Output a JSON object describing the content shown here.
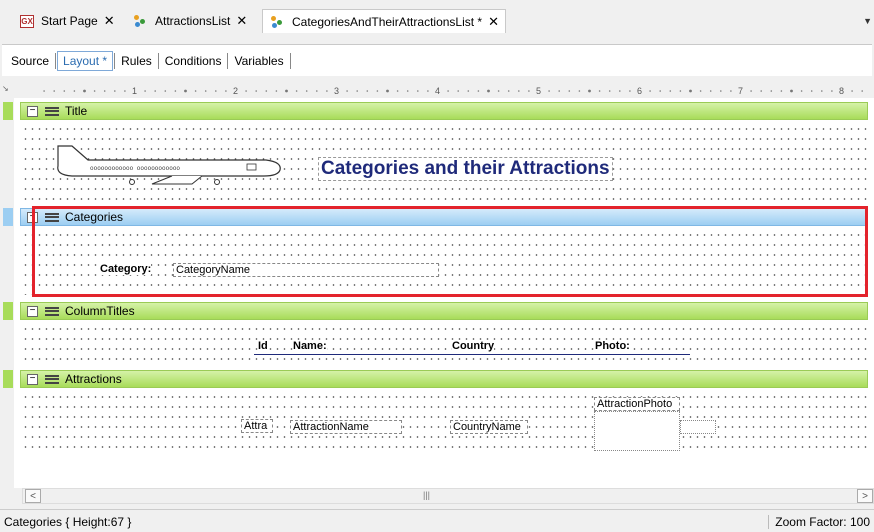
{
  "tabs": [
    {
      "label": "Start Page",
      "close": "✕",
      "icon": "gx-logo-icon"
    },
    {
      "label": "AttractionsList",
      "close": "✕",
      "icon": "object-icon"
    },
    {
      "label": "CategoriesAndTheirAttractionsList *",
      "close": "✕",
      "icon": "object-icon",
      "active": true
    }
  ],
  "gx_logo_text": "GX",
  "subtabs": [
    "Source",
    "Layout *",
    "Rules",
    "Conditions",
    "Variables"
  ],
  "ruler": {
    "marks": [
      "1",
      "2",
      "3",
      "4",
      "5",
      "6",
      "7",
      "8"
    ]
  },
  "bands": {
    "title": {
      "label": "Title",
      "heading": "Categories and their Attractions"
    },
    "categories": {
      "label": "Categories",
      "field_label": "Category:",
      "field_value": "CategoryName"
    },
    "column_titles": {
      "label": "ColumnTitles",
      "col_id": "Id",
      "col_name": "Name:",
      "col_country": "Country",
      "col_photo": "Photo:"
    },
    "attractions": {
      "label": "Attractions",
      "attr_id": "Attra",
      "attr_name": "AttractionName",
      "attr_country": "CountryName",
      "attr_photo": "AttractionPhoto"
    }
  },
  "plane": {
    "text": "oooooooooooo  oooooooooooo"
  },
  "status": {
    "left": "Categories { Height:67 }",
    "right": "Zoom Factor: 100"
  },
  "colors": {
    "band_green": "#a8dc5a",
    "band_blue": "#9ccef2",
    "selection": "#e3232c",
    "title_text": "#1f2a7a",
    "active_subtab": "#2b6cb0"
  }
}
